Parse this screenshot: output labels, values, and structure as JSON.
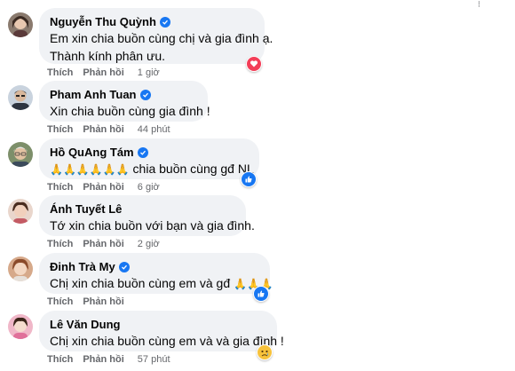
{
  "labels": {
    "like": "Thích",
    "reply": "Phản hồi"
  },
  "colors": {
    "bubble": "#f0f2f5",
    "verified": "#1877f2",
    "meta": "#65676b"
  },
  "comments": [
    {
      "name": "Nguyễn Thu Quỳnh",
      "verified": true,
      "lines": [
        "Em xin chia buồn cùng chị và gia đình ạ.",
        "Thành kính phân ưu."
      ],
      "time": "1 giờ",
      "reaction": "love-icon"
    },
    {
      "name": "Pham Anh Tuan",
      "verified": true,
      "lines": [
        "Xin chia buồn cùng gia đình !"
      ],
      "time": "44 phút",
      "reaction": ""
    },
    {
      "name": "Hồ QuAng Tám",
      "verified": true,
      "prefix_emoji": "🙏🙏🙏🙏🙏🙏",
      "lines": [
        " chia buồn cùng gđ NL"
      ],
      "time": "6 giờ",
      "reaction": "like-icon"
    },
    {
      "name": "Ánh Tuyết Lê",
      "verified": false,
      "lines": [
        "Tớ xin chia buồn với bạn và gia đình."
      ],
      "time": "2 giờ",
      "reaction": ""
    },
    {
      "name": "Đinh Trà My",
      "verified": true,
      "lines": [
        "Chị xin chia buồn cùng em và gđ "
      ],
      "suffix_emoji": "🙏🙏🙏",
      "time": "",
      "reaction": "like-icon"
    },
    {
      "name": "Lê Văn Dung",
      "verified": false,
      "lines": [
        "Chị xin chia buồn cùng em và và gia đình !"
      ],
      "time": "57 phút",
      "reaction": "sad-icon"
    }
  ]
}
